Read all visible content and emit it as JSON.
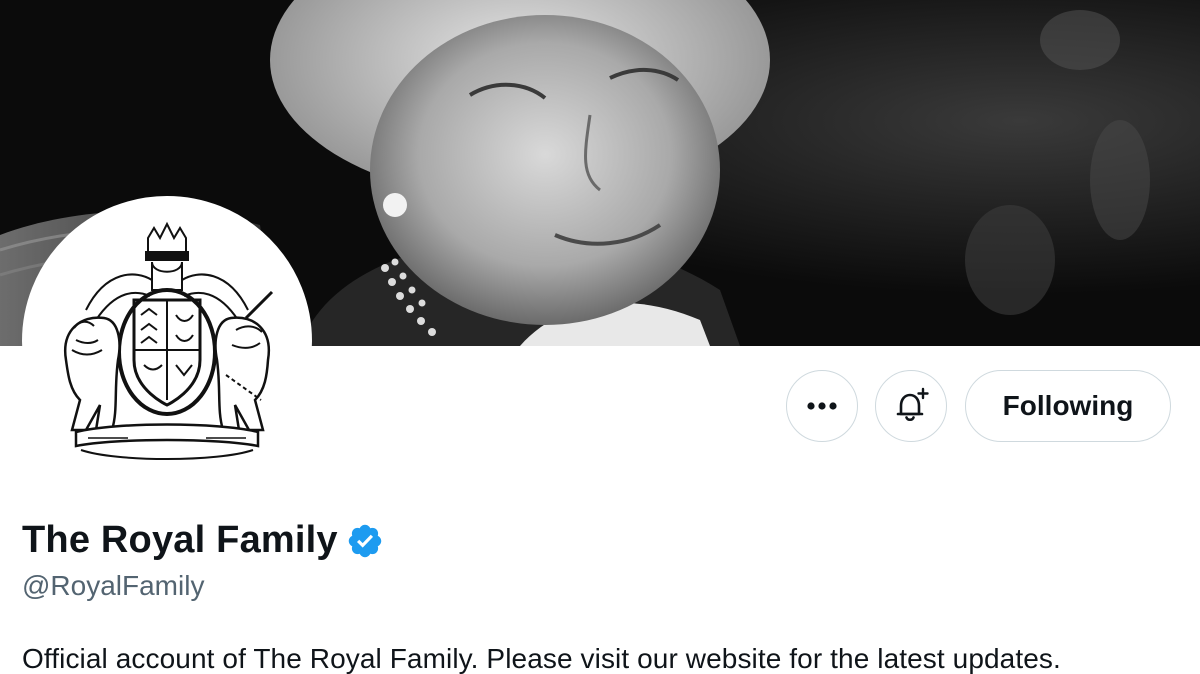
{
  "profile": {
    "display_name": "The Royal Family",
    "handle": "@RoyalFamily",
    "bio": "Official account of The Royal Family. Please visit our website for the latest updates.",
    "verified": true
  },
  "banner": {
    "description_icon": "portrait-photo"
  },
  "avatar": {
    "icon": "royal-coat-of-arms"
  },
  "actions": {
    "more_icon": "ellipsis-icon",
    "notify_icon": "bell-plus-icon",
    "follow_label": "Following"
  },
  "colors": {
    "text_primary": "#0f1419",
    "text_secondary": "#536471",
    "border": "#cfd9de",
    "verified_blue": "#1d9bf0"
  }
}
